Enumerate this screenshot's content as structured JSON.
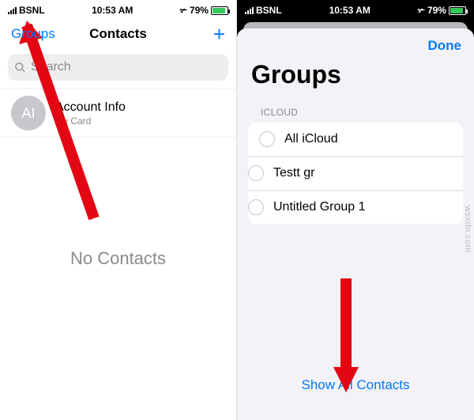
{
  "annotation": {
    "watermark": "wsxdn.com"
  },
  "left": {
    "status": {
      "carrier": "BSNL",
      "time": "10:53 AM",
      "battery_pct": "79%"
    },
    "nav": {
      "groups": "Groups",
      "title": "Contacts",
      "add": "+"
    },
    "search": {
      "placeholder": "Search"
    },
    "mycard": {
      "initials": "AI",
      "name": "Account Info",
      "sub": "My Card"
    },
    "empty": "No Contacts"
  },
  "right": {
    "status": {
      "carrier": "BSNL",
      "time": "10:53 AM",
      "battery_pct": "79%"
    },
    "sheet": {
      "done": "Done",
      "title": "Groups",
      "section": "ICLOUD",
      "items": [
        {
          "label": "All iCloud"
        },
        {
          "label": "Testt gr"
        },
        {
          "label": "Untitled Group 1"
        }
      ],
      "show_all": "Show All Contacts"
    }
  }
}
